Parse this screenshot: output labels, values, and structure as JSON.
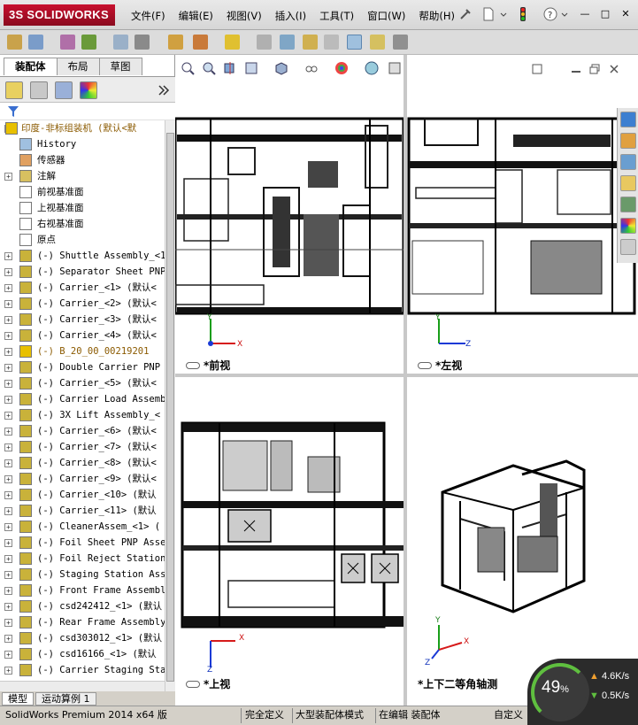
{
  "app": {
    "logo": "3S SOLIDWORKS"
  },
  "menu": [
    "文件(F)",
    "编辑(E)",
    "视图(V)",
    "插入(I)",
    "工具(T)",
    "窗口(W)",
    "帮助(H)"
  ],
  "window_buttons": [
    "—",
    "□",
    "✕"
  ],
  "panel_tabs": [
    "装配体",
    "布局",
    "草图"
  ],
  "tree": [
    {
      "label": "印度-非标组装机  (默认<默",
      "icon": "warning-assembly-icon",
      "expand": "-",
      "indent": 0,
      "color": "#8b5a00"
    },
    {
      "label": "History",
      "icon": "history-icon",
      "expand": "",
      "indent": 1
    },
    {
      "label": "传感器",
      "icon": "sensor-icon",
      "expand": "",
      "indent": 1
    },
    {
      "label": "注解",
      "icon": "annotation-icon",
      "expand": "+",
      "indent": 1
    },
    {
      "label": "前视基准面",
      "icon": "plane-icon",
      "expand": "",
      "indent": 1
    },
    {
      "label": "上视基准面",
      "icon": "plane-icon",
      "expand": "",
      "indent": 1
    },
    {
      "label": "右视基准面",
      "icon": "plane-icon",
      "expand": "",
      "indent": 1
    },
    {
      "label": "原点",
      "icon": "origin-icon",
      "expand": "",
      "indent": 1
    },
    {
      "label": "(-) Shuttle Assembly_<1",
      "icon": "assembly-icon",
      "expand": "+",
      "indent": 1
    },
    {
      "label": "(-) Separator Sheet PNP",
      "icon": "assembly-icon",
      "expand": "+",
      "indent": 1
    },
    {
      "label": "(-) Carrier_<1> (默认<",
      "icon": "assembly-icon",
      "expand": "+",
      "indent": 1
    },
    {
      "label": "(-) Carrier_<2> (默认<",
      "icon": "assembly-icon",
      "expand": "+",
      "indent": 1
    },
    {
      "label": "(-) Carrier_<3> (默认<",
      "icon": "assembly-icon",
      "expand": "+",
      "indent": 1
    },
    {
      "label": "(-) Carrier_<4> (默认<",
      "icon": "assembly-icon",
      "expand": "+",
      "indent": 1
    },
    {
      "label": "(-) B_20_00_00219201",
      "icon": "warning-assembly-icon",
      "expand": "+",
      "indent": 1,
      "color": "#8b5a00"
    },
    {
      "label": "(-) Double Carrier PNP",
      "icon": "assembly-icon",
      "expand": "+",
      "indent": 1
    },
    {
      "label": "(-) Carrier_<5> (默认<",
      "icon": "assembly-icon",
      "expand": "+",
      "indent": 1
    },
    {
      "label": "(-) Carrier Load Assemb",
      "icon": "assembly-icon",
      "expand": "+",
      "indent": 1
    },
    {
      "label": "(-) 3X Lift Assembly_<",
      "icon": "assembly-icon",
      "expand": "+",
      "indent": 1
    },
    {
      "label": "(-) Carrier_<6> (默认<",
      "icon": "assembly-icon",
      "expand": "+",
      "indent": 1
    },
    {
      "label": "(-) Carrier_<7> (默认<",
      "icon": "assembly-icon",
      "expand": "+",
      "indent": 1
    },
    {
      "label": "(-) Carrier_<8> (默认<",
      "icon": "assembly-icon",
      "expand": "+",
      "indent": 1
    },
    {
      "label": "(-) Carrier_<9> (默认<",
      "icon": "assembly-icon",
      "expand": "+",
      "indent": 1
    },
    {
      "label": "(-) Carrier_<10> (默认",
      "icon": "assembly-icon",
      "expand": "+",
      "indent": 1
    },
    {
      "label": "(-) Carrier_<11> (默认",
      "icon": "assembly-icon",
      "expand": "+",
      "indent": 1
    },
    {
      "label": "(-) CleanerAssem_<1> (",
      "icon": "assembly-icon",
      "expand": "+",
      "indent": 1
    },
    {
      "label": "(-) Foil Sheet PNP Asse",
      "icon": "assembly-icon",
      "expand": "+",
      "indent": 1
    },
    {
      "label": "(-) Foil Reject Station",
      "icon": "assembly-icon",
      "expand": "+",
      "indent": 1
    },
    {
      "label": "(-) Staging Station Ass",
      "icon": "assembly-icon",
      "expand": "+",
      "indent": 1
    },
    {
      "label": "(-) Front Frame Assembl",
      "icon": "assembly-icon",
      "expand": "+",
      "indent": 1
    },
    {
      "label": "(-) csd242412_<1> (默认",
      "icon": "assembly-icon",
      "expand": "+",
      "indent": 1
    },
    {
      "label": "(-) Rear Frame Assembly",
      "icon": "assembly-icon",
      "expand": "+",
      "indent": 1
    },
    {
      "label": "(-) csd303012_<1> (默认",
      "icon": "assembly-icon",
      "expand": "+",
      "indent": 1
    },
    {
      "label": "(-) csd16166_<1> (默认",
      "icon": "assembly-icon",
      "expand": "+",
      "indent": 1
    },
    {
      "label": "(-) Carrier Staging Sta",
      "icon": "assembly-icon",
      "expand": "+",
      "indent": 1
    }
  ],
  "bottom_tabs": [
    "模型",
    "运动算例 1"
  ],
  "views": [
    {
      "label": "*前视",
      "axes": [
        "Y",
        "X"
      ]
    },
    {
      "label": "*左视",
      "axes": [
        "Y",
        "Z"
      ]
    },
    {
      "label": "*上视",
      "axes": [
        "X",
        "Z"
      ]
    },
    {
      "label": "*上下二等角轴测",
      "axes": [
        "Y",
        "X",
        "Z"
      ]
    }
  ],
  "status": {
    "product": "SolidWorks Premium 2014 x64 版",
    "definition": "完全定义",
    "mode": "大型装配体模式",
    "editing": "在编辑 装配体",
    "custom": "自定义"
  },
  "speed": {
    "percent": "49",
    "percent_sign": "%",
    "up": "4.6",
    "up_unit": "K/s",
    "down": "0.5",
    "down_unit": "K/s",
    "percent_value": 0.49
  },
  "colors": {
    "brand": "#c8102e",
    "gauge": "#5fbf3f",
    "warning": "#e8c000"
  }
}
